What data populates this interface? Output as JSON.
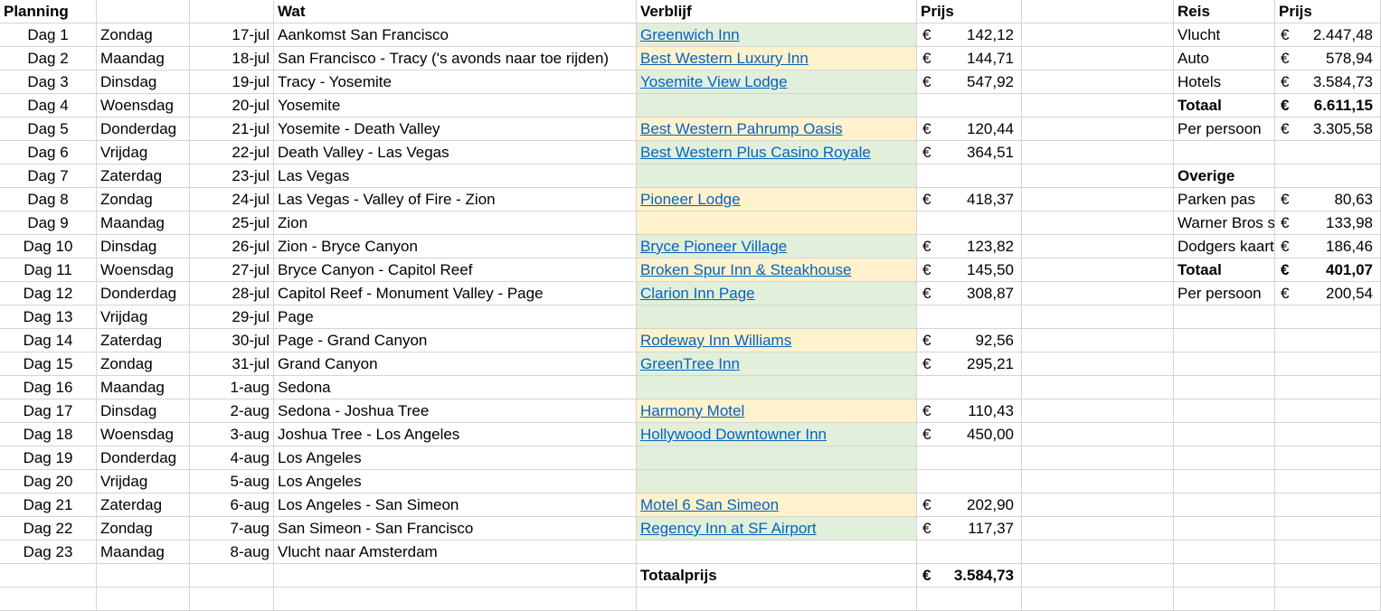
{
  "headers": {
    "planning": "Planning",
    "wat": "Wat",
    "verblijf": "Verblijf",
    "prijs": "Prijs",
    "reis": "Reis",
    "prijs2": "Prijs"
  },
  "currency": "€",
  "colors": {
    "green": "#e2efda",
    "yellow": "#fff2cc",
    "link": "#0563c1"
  },
  "rows": [
    {
      "dag": "Dag 1",
      "weekday": "Zondag",
      "date": "17-jul",
      "wat": "Aankomst San Francisco",
      "verblijf": "Greenwich Inn",
      "prijs": "142,12",
      "fill": "green"
    },
    {
      "dag": "Dag 2",
      "weekday": "Maandag",
      "date": "18-jul",
      "wat": "San Francisco - Tracy ('s avonds naar toe rijden)",
      "verblijf": "Best Western Luxury Inn",
      "prijs": "144,71",
      "fill": "yellow"
    },
    {
      "dag": "Dag 3",
      "weekday": "Dinsdag",
      "date": "19-jul",
      "wat": "Tracy - Yosemite",
      "verblijf": "Yosemite View Lodge",
      "prijs": "547,92",
      "fill": "green"
    },
    {
      "dag": "Dag 4",
      "weekday": "Woensdag",
      "date": "20-jul",
      "wat": "Yosemite",
      "verblijf": "",
      "prijs": "",
      "fill": "green"
    },
    {
      "dag": "Dag 5",
      "weekday": "Donderdag",
      "date": "21-jul",
      "wat": "Yosemite - Death Valley",
      "verblijf": "Best Western Pahrump Oasis",
      "prijs": "120,44",
      "fill": "yellow"
    },
    {
      "dag": "Dag 6",
      "weekday": "Vrijdag",
      "date": "22-jul",
      "wat": "Death Valley - Las Vegas",
      "verblijf": "Best Western Plus Casino Royale",
      "prijs": "364,51",
      "fill": "green"
    },
    {
      "dag": "Dag 7",
      "weekday": "Zaterdag",
      "date": "23-jul",
      "wat": "Las Vegas",
      "verblijf": "",
      "prijs": "",
      "fill": "green"
    },
    {
      "dag": "Dag 8",
      "weekday": "Zondag",
      "date": "24-jul",
      "wat": "Las Vegas - Valley of Fire - Zion",
      "verblijf": "Pioneer Lodge",
      "prijs": "418,37",
      "fill": "yellow"
    },
    {
      "dag": "Dag 9",
      "weekday": "Maandag",
      "date": "25-jul",
      "wat": "Zion",
      "verblijf": "",
      "prijs": "",
      "fill": "yellow"
    },
    {
      "dag": "Dag 10",
      "weekday": "Dinsdag",
      "date": "26-jul",
      "wat": "Zion - Bryce Canyon",
      "verblijf": "Bryce Pioneer Village",
      "prijs": "123,82",
      "fill": "green"
    },
    {
      "dag": "Dag 11",
      "weekday": "Woensdag",
      "date": "27-jul",
      "wat": "Bryce Canyon - Capitol Reef",
      "verblijf": "Broken Spur Inn & Steakhouse",
      "prijs": "145,50",
      "fill": "yellow"
    },
    {
      "dag": "Dag 12",
      "weekday": "Donderdag",
      "date": "28-jul",
      "wat": "Capitol Reef - Monument Valley - Page",
      "verblijf": "Clarion Inn Page",
      "prijs": "308,87",
      "fill": "green"
    },
    {
      "dag": "Dag 13",
      "weekday": "Vrijdag",
      "date": "29-jul",
      "wat": "Page",
      "verblijf": "",
      "prijs": "",
      "fill": "green"
    },
    {
      "dag": "Dag 14",
      "weekday": "Zaterdag",
      "date": "30-jul",
      "wat": "Page - Grand Canyon",
      "verblijf": "Rodeway Inn Williams",
      "prijs": "92,56",
      "fill": "yellow"
    },
    {
      "dag": "Dag 15",
      "weekday": "Zondag",
      "date": "31-jul",
      "wat": "Grand Canyon",
      "verblijf": "GreenTree Inn",
      "prijs": "295,21",
      "fill": "green"
    },
    {
      "dag": "Dag 16",
      "weekday": "Maandag",
      "date": "1-aug",
      "wat": "Sedona",
      "verblijf": "",
      "prijs": "",
      "fill": "green"
    },
    {
      "dag": "Dag 17",
      "weekday": "Dinsdag",
      "date": "2-aug",
      "wat": "Sedona - Joshua Tree",
      "verblijf": "Harmony Motel",
      "prijs": "110,43",
      "fill": "yellow"
    },
    {
      "dag": "Dag 18",
      "weekday": "Woensdag",
      "date": "3-aug",
      "wat": "Joshua Tree - Los Angeles",
      "verblijf": "Hollywood Downtowner Inn",
      "prijs": "450,00",
      "fill": "green"
    },
    {
      "dag": "Dag 19",
      "weekday": "Donderdag",
      "date": "4-aug",
      "wat": "Los Angeles",
      "verblijf": "",
      "prijs": "",
      "fill": "green"
    },
    {
      "dag": "Dag 20",
      "weekday": "Vrijdag",
      "date": "5-aug",
      "wat": "Los Angeles",
      "verblijf": "",
      "prijs": "",
      "fill": "green"
    },
    {
      "dag": "Dag 21",
      "weekday": "Zaterdag",
      "date": "6-aug",
      "wat": "Los Angeles - San Simeon",
      "verblijf": "Motel 6 San Simeon",
      "prijs": "202,90",
      "fill": "yellow"
    },
    {
      "dag": "Dag 22",
      "weekday": "Zondag",
      "date": "7-aug",
      "wat": "San Simeon - San Francisco",
      "verblijf": "Regency Inn at SF Airport ",
      "prijs": "117,37",
      "fill": "green"
    },
    {
      "dag": "Dag 23",
      "weekday": "Maandag",
      "date": "8-aug",
      "wat": "Vlucht naar Amsterdam",
      "verblijf": "",
      "prijs": "",
      "fill": "none"
    }
  ],
  "totaal": {
    "label": "Totaalprijs",
    "value": "3.584,73"
  },
  "summary": [
    {
      "label": "Vlucht",
      "value": "2.447,48",
      "bold": false
    },
    {
      "label": "Auto",
      "value": "578,94",
      "bold": false
    },
    {
      "label": "Hotels",
      "value": "3.584,73",
      "bold": false
    },
    {
      "label": "Totaal",
      "value": "6.611,15",
      "bold": true
    },
    {
      "label": "Per persoon",
      "value": "3.305,58",
      "bold": false
    },
    {
      "label": "",
      "value": "",
      "bold": false
    },
    {
      "label": "Overige",
      "value": "",
      "bold": true
    },
    {
      "label": "Parken pas",
      "value": "80,63",
      "bold": false
    },
    {
      "label": "Warner Bros studio",
      "value": "133,98",
      "bold": false
    },
    {
      "label": "Dodgers kaarten",
      "value": "186,46",
      "bold": false
    },
    {
      "label": "Totaal",
      "value": "401,07",
      "bold": true
    },
    {
      "label": "Per persoon",
      "value": "200,54",
      "bold": false
    }
  ]
}
